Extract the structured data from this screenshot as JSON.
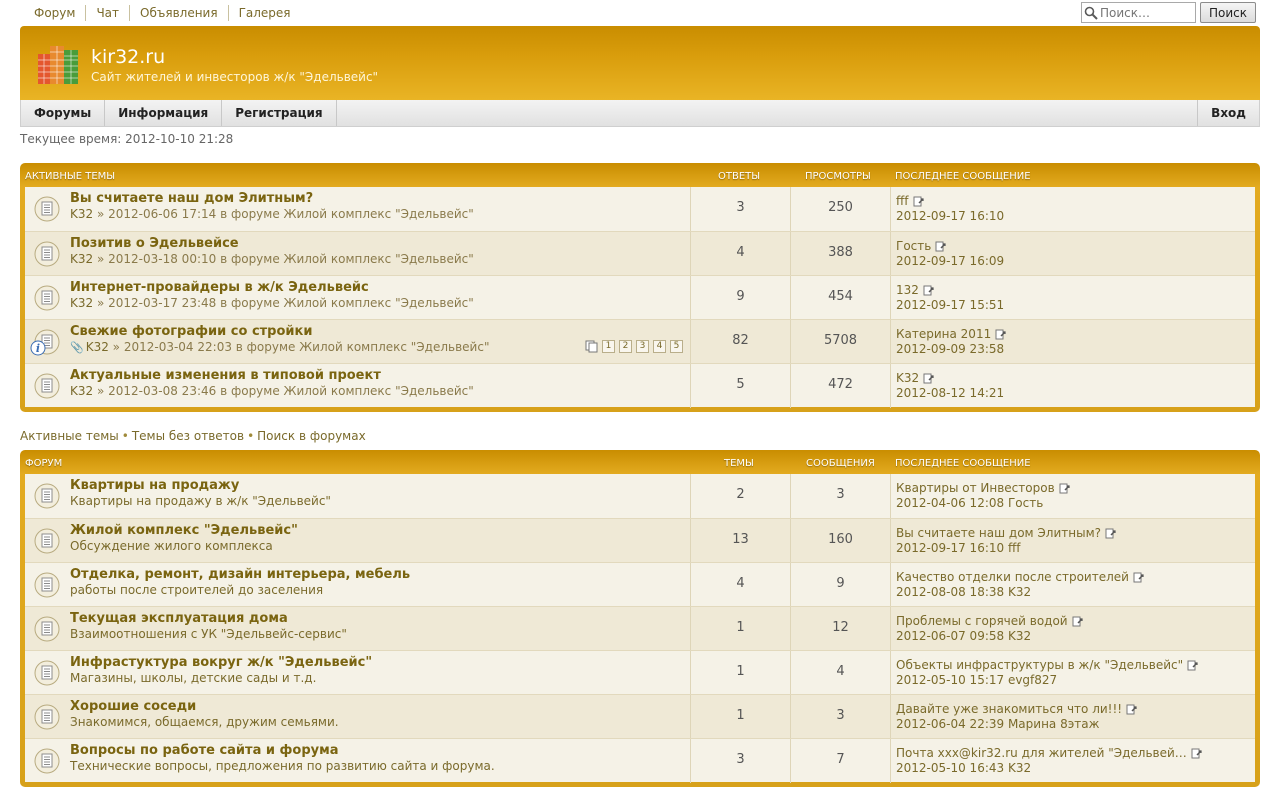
{
  "toplinks": [
    "Форум",
    "Чат",
    "Объявления",
    "Галерея"
  ],
  "search": {
    "placeholder": "Поиск…",
    "button": "Поиск"
  },
  "site": {
    "title": "kir32.ru",
    "description": "Сайт жителей и инвесторов ж/к \"Эдельвейс\""
  },
  "nav": {
    "items": [
      "Форумы",
      "Информация",
      "Регистрация"
    ],
    "login": "Вход"
  },
  "current_time": "Текущее время: 2012-10-10 21:28",
  "active": {
    "headers": [
      "Активные темы",
      "Ответы",
      "Просмотры",
      "Последнее сообщение"
    ],
    "topics": [
      {
        "title": "Вы считаете наш дом Элитным?",
        "author": "K32",
        "date": "» 2012-06-06 17:14 в форуме Жилой комплекс \"Эдельвейс\"",
        "replies": "3",
        "views": "250",
        "last_author": "fff",
        "last_date": "2012-09-17 16:10"
      },
      {
        "title": "Позитив о Эдельвейсе",
        "author": "K32",
        "date": "» 2012-03-18 00:10 в форуме Жилой комплекс \"Эдельвейс\"",
        "replies": "4",
        "views": "388",
        "last_author": "Гость",
        "last_date": "2012-09-17 16:09"
      },
      {
        "title": "Интернет-провайдеры в ж/к Эдельвейс",
        "author": "K32",
        "date": "» 2012-03-17 23:48 в форуме Жилой комплекс \"Эдельвейс\"",
        "replies": "9",
        "views": "454",
        "last_author": "132",
        "last_date": "2012-09-17 15:51"
      },
      {
        "title": "Свежие фотографии со стройки",
        "author": "K32",
        "date": "» 2012-03-04 22:03 в форуме Жилой комплекс \"Эдельвейс\"",
        "replies": "82",
        "views": "5708",
        "last_author": "Катерина 2011",
        "last_date": "2012-09-09 23:58",
        "pages": [
          "1",
          "2",
          "3",
          "4",
          "5"
        ]
      },
      {
        "title": "Актуальные изменения в типовой проект",
        "author": "K32",
        "date": "» 2012-03-08 23:46 в форуме Жилой комплекс \"Эдельвейс\"",
        "replies": "5",
        "views": "472",
        "last_author": "K32",
        "last_date": "2012-08-12 14:21"
      }
    ]
  },
  "quicklinks": [
    "Активные темы",
    "Темы без ответов",
    "Поиск в форумах"
  ],
  "forums": {
    "headers": [
      "Форум",
      "Темы",
      "Сообщения",
      "Последнее сообщение"
    ],
    "items": [
      {
        "title": "Квартиры на продажу",
        "desc": "Квартиры на продажу в ж/к \"Эдельвейс\"",
        "topics": "2",
        "posts": "3",
        "last_title": "Квартиры от Инвесторов",
        "last_date": "2012-04-06 12:08 Гость"
      },
      {
        "title": "Жилой комплекс \"Эдельвейс\"",
        "desc": "Обсуждение жилого комплекса",
        "topics": "13",
        "posts": "160",
        "last_title": "Вы считаете наш дом Элитным?",
        "last_date": "2012-09-17 16:10 fff"
      },
      {
        "title": "Отделка, ремонт, дизайн интерьера, мебель",
        "desc": "работы после строителей до заселения",
        "topics": "4",
        "posts": "9",
        "last_title": "Качество отделки после строителей",
        "last_date": "2012-08-08 18:38 K32"
      },
      {
        "title": "Текущая эксплуатация дома",
        "desc": "Взаимоотношения с УК \"Эдельвейс-сервис\"",
        "topics": "1",
        "posts": "12",
        "last_title": "Проблемы с горячей водой",
        "last_date": "2012-06-07 09:58 K32"
      },
      {
        "title": "Инфрастуктура вокруг ж/к \"Эдельвейс\"",
        "desc": "Магазины, школы, детские сады и т.д.",
        "topics": "1",
        "posts": "4",
        "last_title": "Объекты инфраструктуры в ж/к \"Эдельвейс\"",
        "last_date": "2012-05-10 15:17 evgf827"
      },
      {
        "title": "Хорошие соседи",
        "desc": "Знакомимся, общаемся, дружим семьями.",
        "topics": "1",
        "posts": "3",
        "last_title": "Давайте уже знакомиться что ли!!!",
        "last_date": "2012-06-04 22:39 Марина 8этаж"
      },
      {
        "title": "Вопросы по работе сайта и форума",
        "desc": "Технические вопросы, предложения по развитию сайта и форума.",
        "topics": "3",
        "posts": "7",
        "last_title": "Почта xxx@kir32.ru для жителей \"Эдельвей…",
        "last_date": "2012-05-10 16:43 K32"
      }
    ]
  },
  "colors": {
    "header_gold": "#d99d0c",
    "link": "#7a6410",
    "row_bg": "#f5f2e7"
  },
  "icons": [
    "search-icon",
    "building-logo-icon",
    "topic-icon",
    "info-icon",
    "attachment-icon",
    "view-last-post-icon",
    "pages-icon"
  ]
}
